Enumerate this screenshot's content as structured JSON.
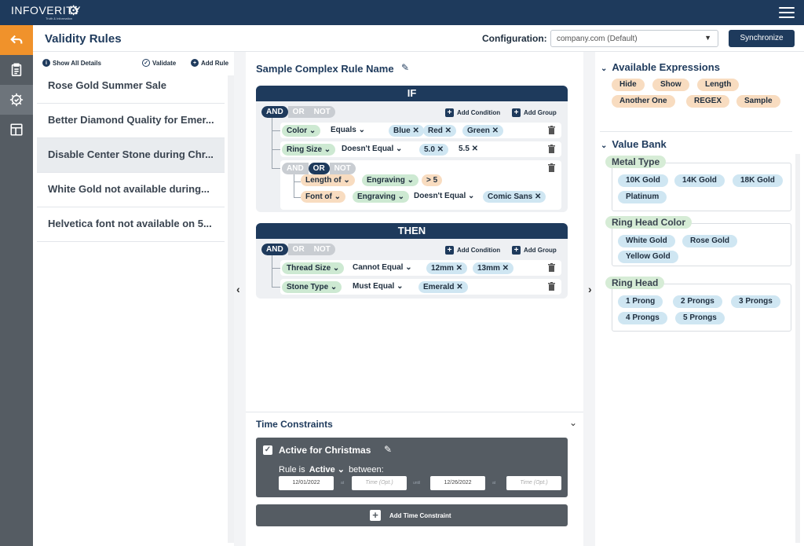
{
  "brand": {
    "name": "INFOVERITY",
    "tagline": "Truth & Information"
  },
  "header": {
    "title": "Validity Rules",
    "config_label": "Configuration:",
    "config_value": "company.com (Default)",
    "sync_label": "Synchronize"
  },
  "rules": {
    "tools": {
      "show_all": "Show All Details",
      "validate": "Validate",
      "add_rule": "Add Rule"
    },
    "items": [
      {
        "label": "Rose Gold Summer Sale"
      },
      {
        "label": "Better Diamond Quality for Emer..."
      },
      {
        "label": "Disable Center Stone during Chr..."
      },
      {
        "label": "White Gold not available during..."
      },
      {
        "label": "Helvetica font not available on 5..."
      }
    ]
  },
  "editor": {
    "rule_name": "Sample Complex Rule Name",
    "logic": {
      "and": "AND",
      "or": "OR",
      "not": "NOT"
    },
    "add_condition": "Add Condition",
    "add_group": "Add Group",
    "if": {
      "title": "IF",
      "row1": {
        "field": "Color",
        "op": "Equals",
        "v1": "Blue",
        "v2": "Red",
        "v3": "Green"
      },
      "row2": {
        "field": "Ring Size",
        "op": "Doesn't Equal",
        "v1": "5.0",
        "v2": "5.5"
      },
      "sub1": {
        "field": "Length of",
        "arg": "Engraving",
        "v1": "> 5"
      },
      "sub2": {
        "field": "Font of",
        "arg": "Engraving",
        "op": "Doesn't Equal",
        "v1": "Comic Sans"
      }
    },
    "then": {
      "title": "THEN",
      "row1": {
        "field": "Thread Size",
        "op": "Cannot Equal",
        "v1": "12mm",
        "v2": "13mm"
      },
      "row2": {
        "field": "Stone Type",
        "op": "Must Equal",
        "v1": "Emerald"
      }
    }
  },
  "time": {
    "title": "Time Constraints",
    "card": {
      "name": "Active for Christmas",
      "rule_is": "Rule is",
      "state": "Active",
      "between": "between:",
      "start": "12/01/2022",
      "end": "12/26/2022",
      "opt_time": "Time (Opt.)",
      "at": "at",
      "to": "until"
    },
    "add_label": "Add Time Constraint"
  },
  "expressions": {
    "title": "Available Expressions",
    "items": [
      "Hide",
      "Show",
      "Length",
      "Another One",
      "REGEX",
      "Sample"
    ]
  },
  "value_bank": {
    "title": "Value Bank",
    "groups": [
      {
        "name": "Metal Type",
        "values": [
          "10K Gold",
          "14K Gold",
          "18K Gold",
          "Platinum"
        ]
      },
      {
        "name": "Ring Head Color",
        "values": [
          "White Gold",
          "Rose Gold",
          "Yellow Gold"
        ]
      },
      {
        "name": "Ring Head",
        "values": [
          "1 Prong",
          "2 Prongs",
          "3 Prongs",
          "4 Prongs",
          "5 Prongs"
        ]
      }
    ]
  },
  "colors": {
    "primary": "#1e3a5c",
    "accent": "#f0922b",
    "nav_bg": "#555c63",
    "chip_green": "#cde9d2",
    "chip_blue": "#cfe6f2",
    "chip_orange": "#f8dcc0"
  }
}
